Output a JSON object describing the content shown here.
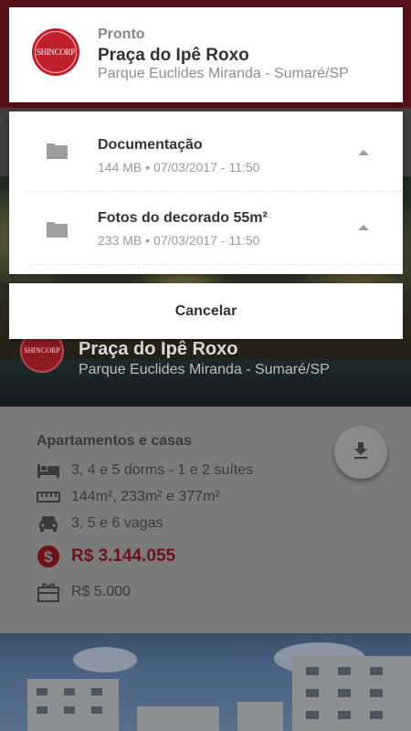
{
  "header": {
    "logo_text": "SHINCORP",
    "status": "Pronto",
    "title": "Praça do Ipê Roxo",
    "subtitle": "Parque Euclides Miranda - Sumaré/SP"
  },
  "files": [
    {
      "name": "Documentação",
      "size": "144 MB",
      "separator": "•",
      "datetime": "07/03/2017 - 11:50",
      "icon": "folder-icon"
    },
    {
      "name": "Fotos do decorado 55m²",
      "size": "233 MB",
      "separator": "•",
      "datetime": "07/03/2017 - 11:50",
      "icon": "folder-icon"
    }
  ],
  "cancel_label": "Cancelar",
  "background": {
    "hero_logo_text": "SHINCORP",
    "title": "Praça do Ipê Roxo",
    "subtitle": "Parque Euclides Miranda - Sumaré/SP",
    "section_heading": "Apartamentos e casas",
    "features": [
      {
        "icon": "bed-icon",
        "text": "3, 4 e 5 dorms - 1 e 2 suítes"
      },
      {
        "icon": "ruler-icon",
        "text": "144m², 233m² e 377m²"
      },
      {
        "icon": "car-icon",
        "text": "3, 5 e 6 vagas"
      },
      {
        "icon": "dollar-icon",
        "text": "R$ 3.144.055"
      },
      {
        "icon": "gift-icon",
        "text": "R$ 5.000"
      }
    ]
  },
  "colors": {
    "brand": "#c0202c",
    "dark_brand": "#5a1219",
    "price": "#6e1219"
  }
}
